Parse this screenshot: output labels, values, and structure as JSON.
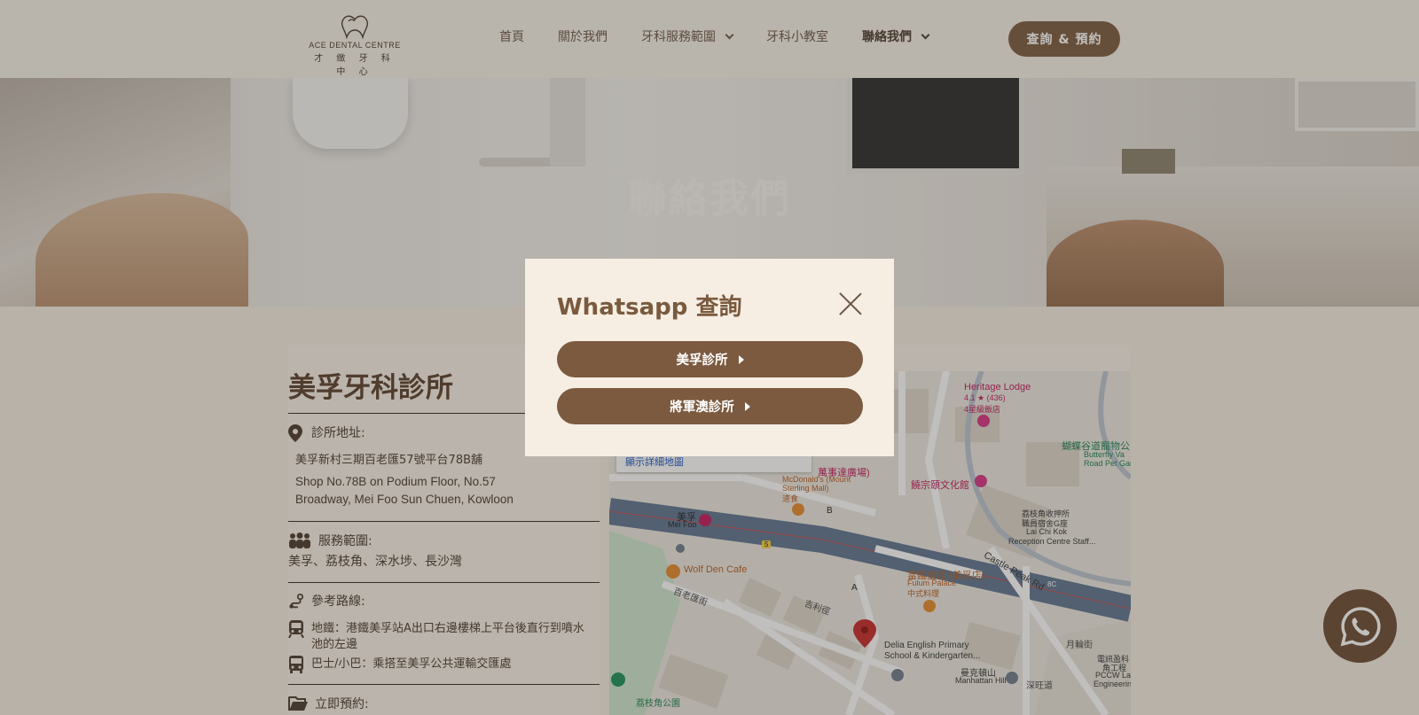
{
  "brand": {
    "name_en": "ACE DENTAL CENTRE",
    "name_zh": "才 緻 牙 科 中 心"
  },
  "nav": {
    "items": [
      {
        "label": "首頁",
        "dropdown": false,
        "active": false
      },
      {
        "label": "關於我們",
        "dropdown": false,
        "active": false
      },
      {
        "label": "牙科服務範圍",
        "dropdown": true,
        "active": false
      },
      {
        "label": "牙科小教室",
        "dropdown": false,
        "active": false
      },
      {
        "label": "聯絡我們",
        "dropdown": true,
        "active": true
      }
    ],
    "cta_label": "查詢 & 預約"
  },
  "hero": {
    "title": "聯絡我們"
  },
  "clinic": {
    "title": "美孚牙科診所",
    "address_label": "診所地址:",
    "address_zh": "美孚新村三期百老匯57號平台78B舖",
    "address_en_1": "Shop No.78B on Podium Floor, No.57",
    "address_en_2": "Broadway, Mei Foo Sun Chuen, Kowloon",
    "service_label": "服務範圍:",
    "service_areas": "美孚、荔枝角、深水埗、長沙灣",
    "route_label": "參考路線:",
    "route_mtr": "地鐵：港鐵美孚站A出口右邊樓梯上平台後直行到噴水",
    "route_mtr_2": "池的左邊",
    "route_bus": "巴士/小巴：乘搭至美孚公共運輸交匯處",
    "book_label": "立即預約:"
  },
  "map": {
    "view_larger": "顯示詳細地圖",
    "labels": [
      "Heritage Lodge",
      "4.1 ★ (436)",
      "4星級飯店",
      "蝴蝶谷道寵物公",
      "Butterfly Va",
      "Road Pet Gar",
      "萬事達廣場)",
      "McDonald's (Mount",
      "Sterling Mall)",
      "速食",
      "饒宗頤文化館",
      "荔枝角收押所",
      "職員宿舍G座",
      "Lai Chi Kok",
      "Reception Centre Staff...",
      "美孚",
      "Mei Foo",
      "Castle Peak Rd",
      "Wolf Den Cafe",
      "富臨皇宮 (美孚店)",
      "Fulum Palace",
      "中式料理",
      "百老匯街",
      "吉利徑",
      "Delia English Primary",
      "School & Kindergarten...",
      "曼克頓山",
      "Manhattan Hill",
      "深旺道",
      "月輪街",
      "荔枝角公園",
      "電訊盈科",
      "角工程",
      "PCCW Lai",
      "Engineerin",
      "B",
      "A",
      "5",
      "8C"
    ]
  },
  "modal": {
    "title": "Whatsapp 查詢",
    "btn_meifoo": "美孚診所",
    "btn_tko": "將軍澳診所"
  },
  "colors": {
    "brand_brown": "#7b5a3f",
    "modal_bg": "#f6eee3"
  },
  "icons": [
    "tooth-logo-icon",
    "chevron-down-icon",
    "close-icon",
    "location-pin-icon",
    "people-icon",
    "route-icon",
    "train-icon",
    "bus-icon",
    "folder-icon",
    "whatsapp-icon",
    "play-arrow-icon"
  ]
}
